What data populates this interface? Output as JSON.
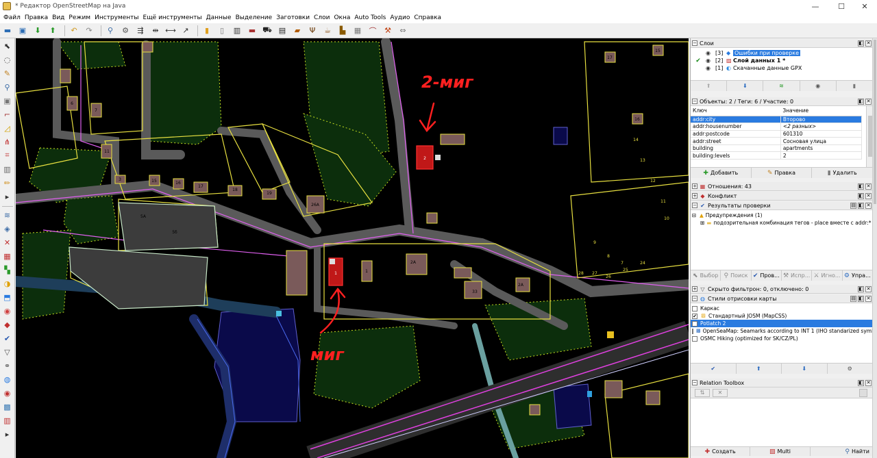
{
  "window": {
    "title": "* Редактор OpenStreetMap на Java",
    "controls": {
      "minimize": "—",
      "maximize": "☐",
      "close": "✕"
    }
  },
  "menu": [
    "Файл",
    "Правка",
    "Вид",
    "Режим",
    "Инструменты",
    "Ещё инструменты",
    "Данные",
    "Выделение",
    "Заготовки",
    "Слои",
    "Окна",
    "Auto Tools",
    "Аудио",
    "Справка"
  ],
  "toolbar_icons": [
    "open-icon",
    "save-icon",
    "download-icon",
    "upload-icon",
    "undo-icon",
    "redo-icon",
    "zoom-icon",
    "preferences-icon",
    "merge-nodes-icon",
    "split-way-icon",
    "combine-way-icon",
    "align-icon",
    "preset-building-icon",
    "preset-entrance-icon",
    "preset-street-icon",
    "preset-barrier-icon",
    "preset-car-icon",
    "preset-bus-icon",
    "preset-shop-icon",
    "preset-restaurant-icon",
    "preset-cafe-icon",
    "preset-industrial-icon",
    "preset-pipeline-icon",
    "preset-bridge-icon",
    "preset-crossing-icon",
    "preset-arrows-icon"
  ],
  "map_annotations": {
    "top_label": "2-миг",
    "bottom_label": "миг"
  },
  "map_labels": [
    "2",
    "1",
    "5А",
    "5б",
    "2А",
    "2А",
    "1",
    "33",
    "15",
    "16",
    "17",
    "18",
    "19",
    "3",
    "11",
    "7",
    "6",
    "26А",
    "17",
    "16",
    "15",
    "14",
    "13",
    "12",
    "11",
    "10",
    "9",
    "8",
    "7",
    "28",
    "27",
    "26",
    "25",
    "24"
  ],
  "layers_panel": {
    "title": "Слои",
    "rows": [
      {
        "num": "[3]",
        "name": "Ошибки при проверке",
        "selected": true,
        "active": false
      },
      {
        "num": "[2]",
        "name": "Слой данных 1 *",
        "selected": false,
        "active": true
      },
      {
        "num": "[1]",
        "name": "Скачанные данные GPX",
        "selected": false,
        "active": false
      }
    ]
  },
  "tags_panel": {
    "title": "Объекты: 2 / Теги: 6 / Участие: 0",
    "columns": [
      "Ключ",
      "Значение"
    ],
    "rows": [
      [
        "addr:city",
        "Второво"
      ],
      [
        "addr:housenumber",
        "<2 разных>"
      ],
      [
        "addr:postcode",
        "601310"
      ],
      [
        "addr:street",
        "Сосновая улица"
      ],
      [
        "building",
        "apartments"
      ],
      [
        "building:levels",
        "2"
      ]
    ],
    "buttons": {
      "add": "Добавить",
      "edit": "Правка",
      "delete": "Удалить"
    }
  },
  "relations_panel": {
    "title": "Отношения: 43"
  },
  "conflict_panel": {
    "title": "Конфликт"
  },
  "validation_panel": {
    "title": "Результаты проверки",
    "tree": {
      "group": "Предупреждения (1)",
      "item": "подозрительная комбинация тегов - place вместе с addr:* (1)"
    },
    "buttons": [
      "Выбор",
      "Поиск",
      "Пров...",
      "Испр...",
      "Игно...",
      "Упра..."
    ]
  },
  "filter_panel": {
    "title": "Скрыто фильтрон: 0, отключено: 0"
  },
  "styles_panel": {
    "title": "Стили отрисовки карты",
    "rows": [
      {
        "name": "Каркас",
        "checked": false,
        "selected": false
      },
      {
        "name": "Стандартный JOSM (MapCSS)",
        "checked": true,
        "selected": false
      },
      {
        "name": "Potlatch 2",
        "checked": false,
        "selected": true
      },
      {
        "name": "OpenSeaMap: Seamarks according to INT 1 (IHO standarized symbols)",
        "checked": false,
        "selected": false
      },
      {
        "name": "OSMC Hiking (optimized for SK/CZ/PL)",
        "checked": false,
        "selected": false
      }
    ]
  },
  "relation_toolbox": {
    "title": "Relation Toolbox",
    "buttons": {
      "create": "Создать",
      "multi": "Multi",
      "find": "Найти"
    }
  }
}
